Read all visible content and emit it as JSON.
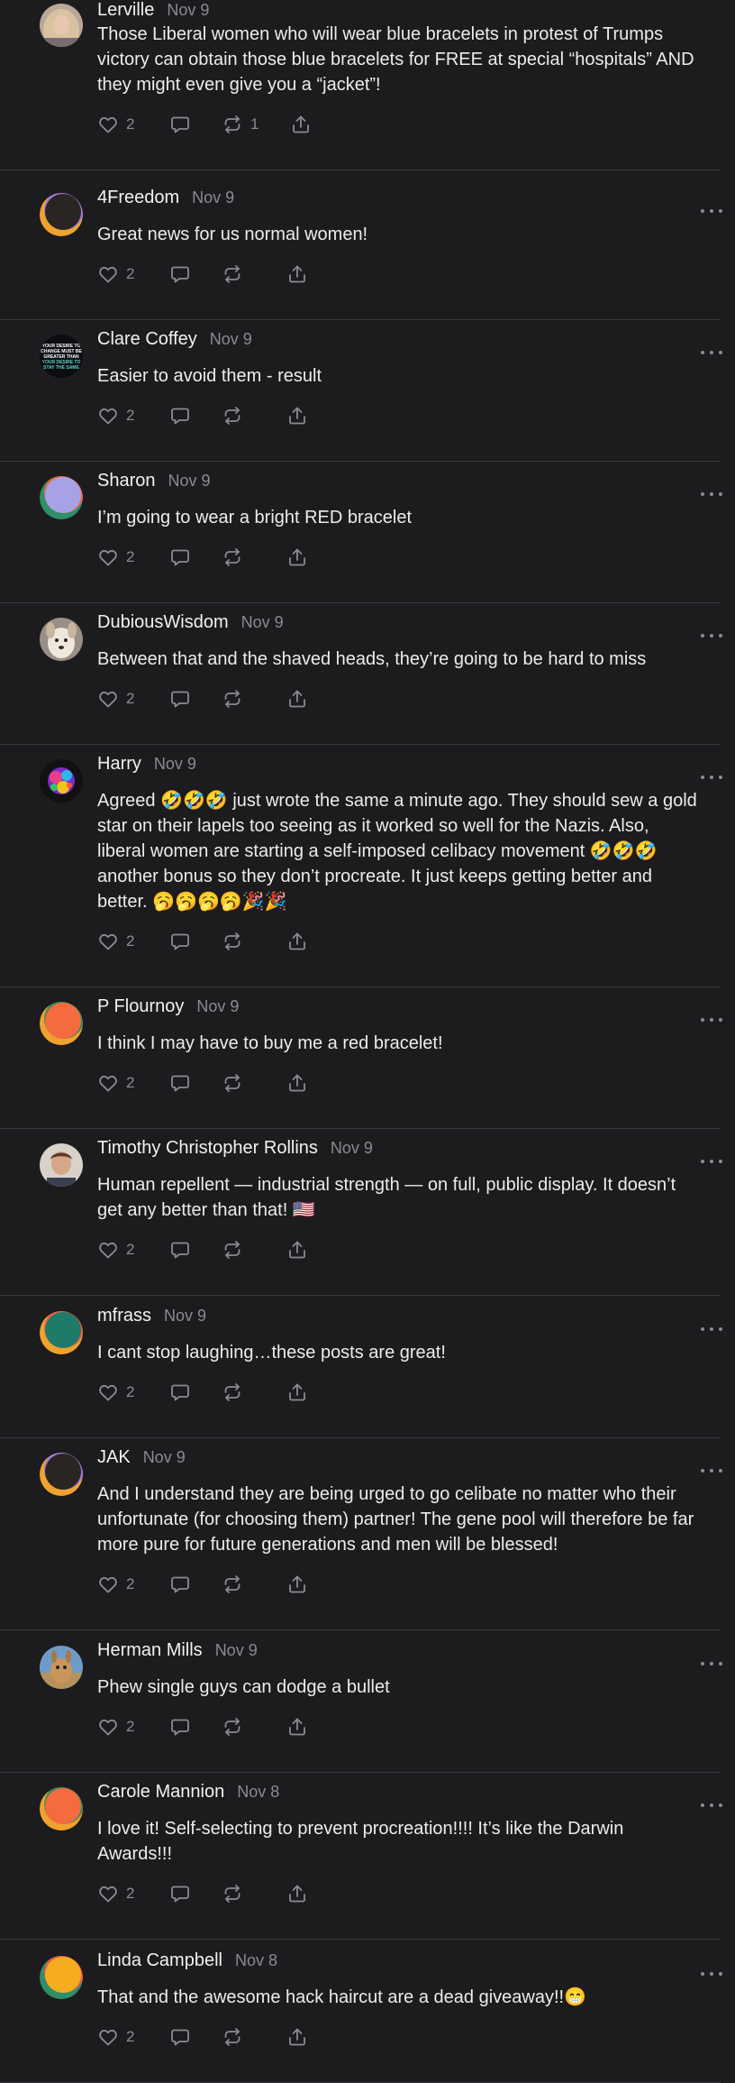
{
  "theme": {
    "background": "#1c1c1e",
    "divider": "#38383c",
    "muted": "#8b8b90",
    "text": "#ececee"
  },
  "comments": [
    {
      "name": "Lerville",
      "date": "Nov 9",
      "text": "Those Liberal women who will wear blue bracelets in protest of Trumps\nvictory can obtain those blue bracelets for FREE at special “hospitals” AND\nthey might even give you a “jacket”!",
      "likes": "2",
      "restacks": "1",
      "avatar": "photo-blonde",
      "more_menu": false
    },
    {
      "name": "4Freedom",
      "date": "Nov 9",
      "text": "Great news for us normal women!",
      "likes": "2",
      "restacks": "",
      "avatar": "default-dark"
    },
    {
      "name": "Clare Coffey",
      "date": "Nov 9",
      "text": "Easier to avoid them - result",
      "likes": "2",
      "restacks": "",
      "avatar": "text-graphic"
    },
    {
      "name": "Sharon",
      "date": "Nov 9",
      "text": "I’m going to wear a bright RED bracelet",
      "likes": "2",
      "restacks": "",
      "avatar": "default-lavender"
    },
    {
      "name": "DubiousWisdom",
      "date": "Nov 9",
      "text": "Between that and the shaved heads, they’re going to be hard to miss",
      "likes": "2",
      "restacks": "",
      "avatar": "photo-dog"
    },
    {
      "name": "Harry",
      "date": "Nov 9",
      "text": "Agreed 🤣🤣🤣 just wrote the same a minute ago. They should sew a gold\nstar on their lapels too seeing as it worked so well for the Nazis. Also,\nliberal women are starting a self-imposed celibacy movement 🤣🤣🤣\nanother bonus so they don’t procreate. It just keeps getting better and\nbetter. 🥱🥱🥱🥱🎉🎉",
      "likes": "2",
      "restacks": "",
      "avatar": "colorful-art"
    },
    {
      "name": "P Flournoy",
      "date": "Nov 9",
      "text": "I think I may have to buy me a red bracelet!",
      "likes": "2",
      "restacks": "",
      "avatar": "default-orange"
    },
    {
      "name": "Timothy Christopher Rollins",
      "date": "Nov 9",
      "text": "Human repellent — industrial strength — on full, public display. It doesn’t\nget any better than that! 🇺🇸",
      "likes": "2",
      "restacks": "",
      "avatar": "photo-man"
    },
    {
      "name": "mfrass",
      "date": "Nov 9",
      "text": "I cant stop laughing…these posts are great!",
      "likes": "2",
      "restacks": "",
      "avatar": "default-teal"
    },
    {
      "name": "JAK",
      "date": "Nov 9",
      "text": "And I understand they are being urged to go celibate no matter who their\nunfortunate (for choosing them) partner! The gene pool will therefore be far\nmore pure for future generations and men will be blessed!",
      "likes": "2",
      "restacks": "",
      "avatar": "default-dark"
    },
    {
      "name": "Herman Mills",
      "date": "Nov 9",
      "text": "Phew single guys can dodge a bullet",
      "likes": "2",
      "restacks": "",
      "avatar": "photo-kangaroo"
    },
    {
      "name": "Carole Mannion",
      "date": "Nov 8",
      "text": "I love it! Self-selecting to prevent procreation!!!! It’s like the Darwin\nAwards!!!",
      "likes": "2",
      "restacks": "",
      "avatar": "default-orange"
    },
    {
      "name": "Linda Campbell",
      "date": "Nov 8",
      "text": "That and the awesome hack haircut are a dead giveaway!!😁",
      "likes": "2",
      "restacks": "",
      "avatar": "default-yellow"
    }
  ],
  "avatar_text": {
    "text-graphic": "YOUR DESIRE TO CHANGE MUST BE GREATER THAN YOUR DESIRE TO STAY THE SAME"
  }
}
